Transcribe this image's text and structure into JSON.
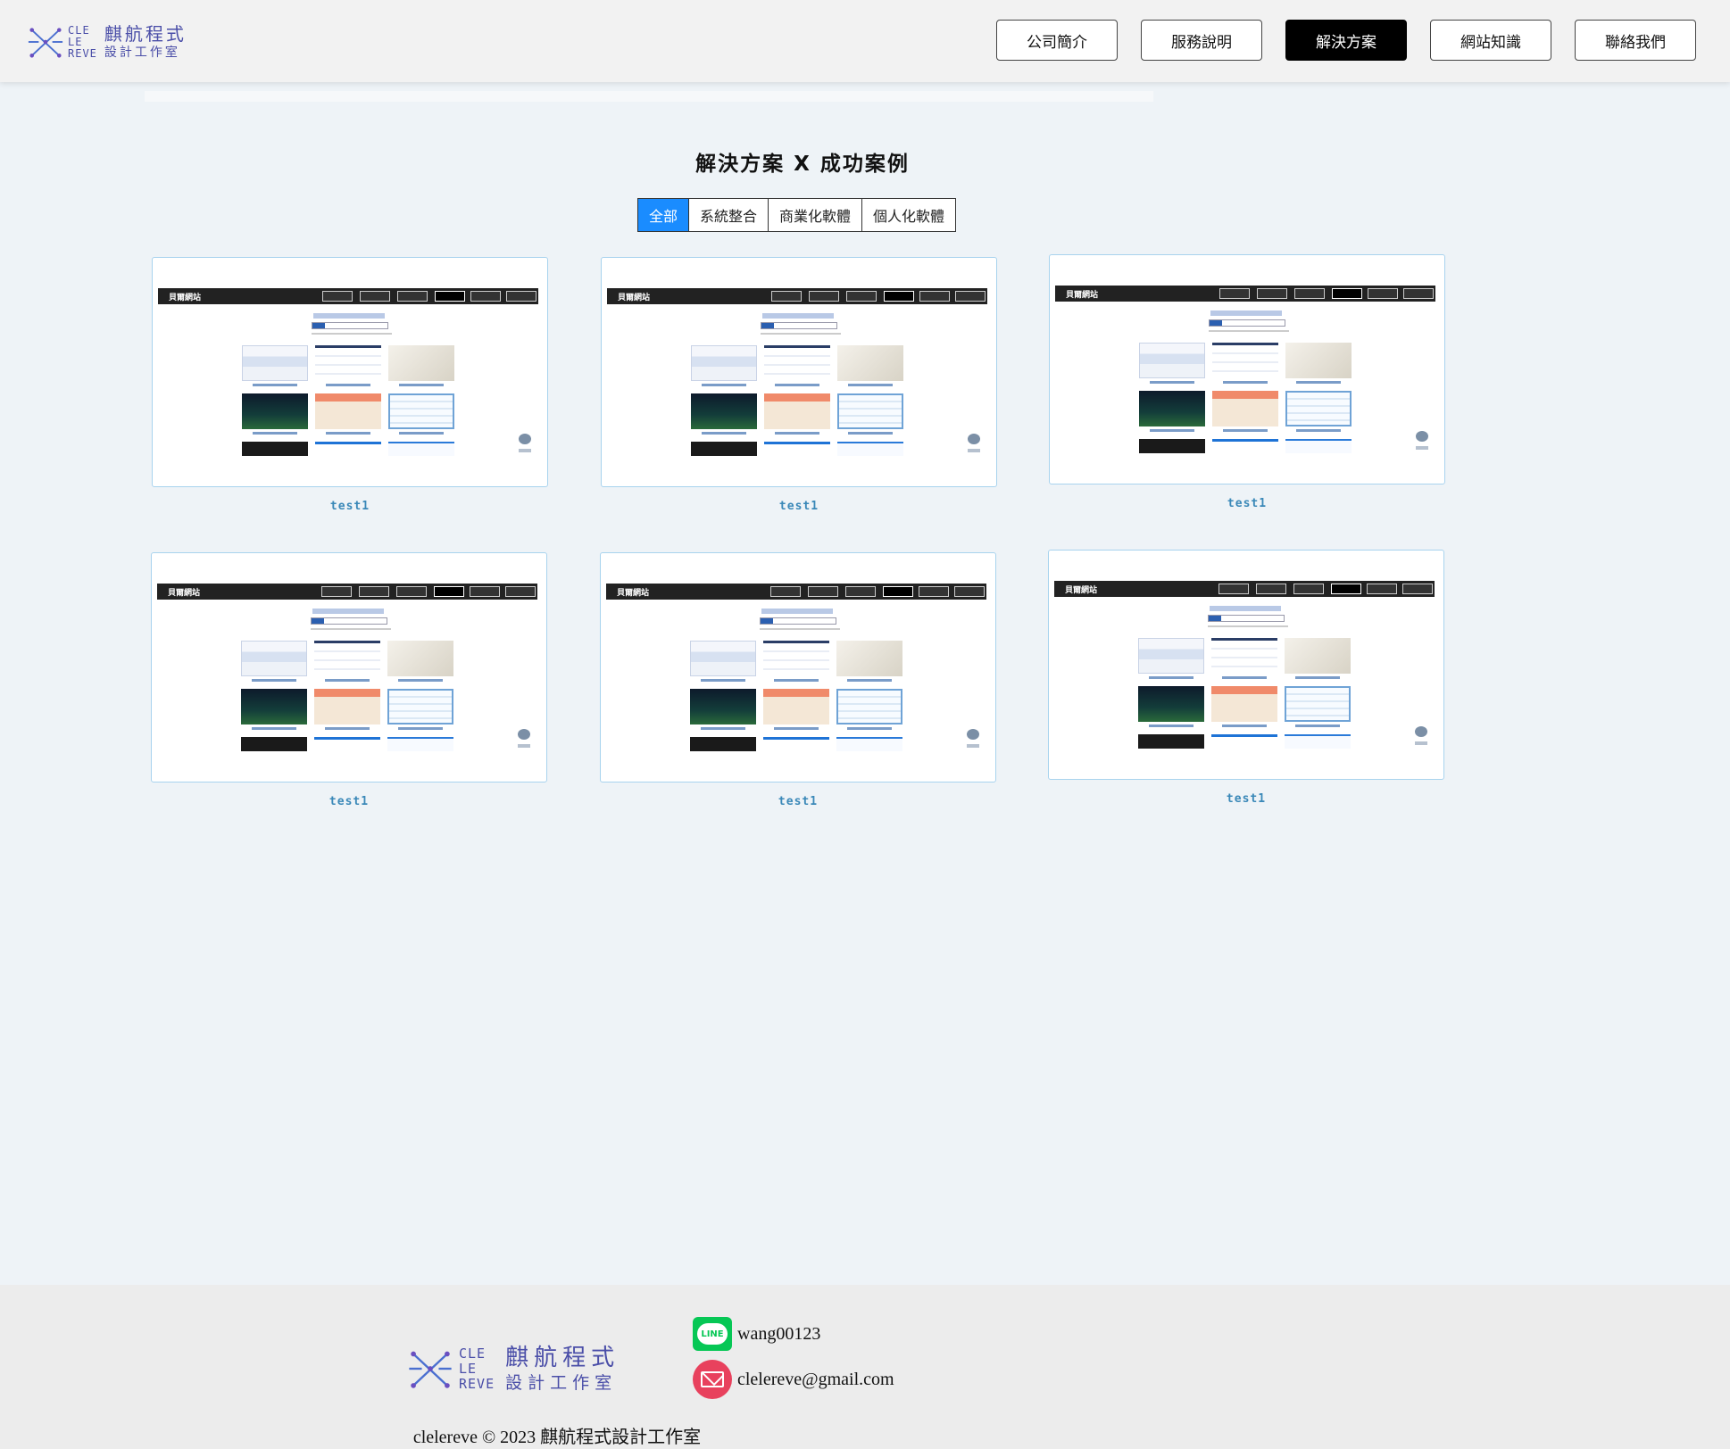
{
  "header": {
    "logo": {
      "tag_lines": [
        "CLE",
        "LE",
        "REVE"
      ],
      "title": "麒航程式",
      "subtitle": "設計工作室"
    },
    "nav": [
      {
        "label": "公司簡介",
        "active": false
      },
      {
        "label": "服務說明",
        "active": false
      },
      {
        "label": "解決方案",
        "active": true
      },
      {
        "label": "網站知識",
        "active": false
      },
      {
        "label": "聯絡我們",
        "active": false
      }
    ]
  },
  "section": {
    "title": "解決方案 X 成功案例",
    "filters": [
      {
        "label": "全部",
        "active": true
      },
      {
        "label": "系統整合",
        "active": false
      },
      {
        "label": "商業化軟體",
        "active": false
      },
      {
        "label": "個人化軟體",
        "active": false
      }
    ],
    "cards": [
      {
        "label": "test1",
        "thumb_brand": "貝爾網站"
      },
      {
        "label": "test1",
        "thumb_brand": "貝爾網站"
      },
      {
        "label": "test1",
        "thumb_brand": "貝爾網站"
      },
      {
        "label": "test1",
        "thumb_brand": "貝爾網站"
      },
      {
        "label": "test1",
        "thumb_brand": "貝爾網站"
      },
      {
        "label": "test1",
        "thumb_brand": "貝爾網站"
      }
    ]
  },
  "footer": {
    "logo": {
      "tag_lines": [
        "CLE",
        "LE",
        "REVE"
      ],
      "title": "麒航程式",
      "subtitle": "設計工作室"
    },
    "line_badge": "LINE",
    "line_id": "wang00123",
    "email": "clelereve@gmail.com",
    "copyright": "clelereve © 2023 麒航程式設計工作室"
  },
  "colors": {
    "accent": "#1a8cff",
    "logo": "#4a4ea8",
    "card_border": "#a8d3ee",
    "card_label": "#3a88b8",
    "line_green": "#06c755",
    "mail_red": "#e8415d"
  },
  "icons": {
    "logo": "circuit-x-logo-icon",
    "line": "line-app-icon",
    "mail": "mail-icon"
  }
}
